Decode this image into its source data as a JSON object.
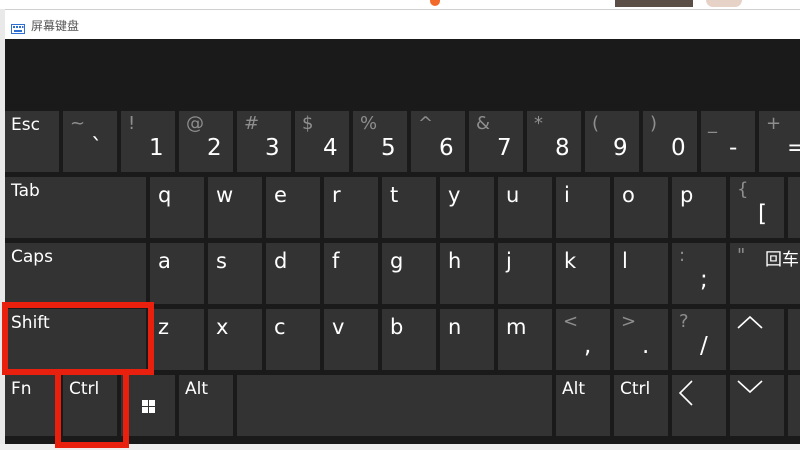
{
  "window": {
    "title": "屏幕键盘"
  },
  "keyboard": {
    "row1": {
      "esc": "Esc",
      "backtick": {
        "shift": "~",
        "main": "`"
      },
      "k1": {
        "shift": "!",
        "main": "1"
      },
      "k2": {
        "shift": "@",
        "main": "2"
      },
      "k3": {
        "shift": "#",
        "main": "3"
      },
      "k4": {
        "shift": "$",
        "main": "4"
      },
      "k5": {
        "shift": "%",
        "main": "5"
      },
      "k6": {
        "shift": "^",
        "main": "6"
      },
      "k7": {
        "shift": "&",
        "main": "7"
      },
      "k8": {
        "shift": "*",
        "main": "8"
      },
      "k9": {
        "shift": "(",
        "main": "9"
      },
      "k0": {
        "shift": ")",
        "main": "0"
      },
      "minus": {
        "shift": "_",
        "main": "-"
      },
      "equals": {
        "shift": "+",
        "main": "="
      }
    },
    "row2": {
      "tab": "Tab",
      "q": "q",
      "w": "w",
      "e": "e",
      "r": "r",
      "t": "t",
      "y": "y",
      "u": "u",
      "i": "i",
      "o": "o",
      "p": "p",
      "lbracket": {
        "shift": "{",
        "main": "["
      },
      "rbracket": {
        "shift": "}",
        "main": "]"
      }
    },
    "row3": {
      "caps": "Caps",
      "a": "a",
      "s": "s",
      "d": "d",
      "f": "f",
      "g": "g",
      "h": "h",
      "j": "j",
      "k": "k",
      "l": "l",
      "semicolon": {
        "shift": ":",
        "main": ";"
      },
      "quote": {
        "shift": "\"",
        "main": "'"
      },
      "enter": "回车"
    },
    "row4": {
      "shift": "Shift",
      "z": "z",
      "x": "x",
      "c": "c",
      "v": "v",
      "b": "b",
      "n": "n",
      "m": "m",
      "comma": {
        "shift": "<",
        "main": ","
      },
      "period": {
        "shift": ">",
        "main": "."
      },
      "slash": {
        "shift": "?",
        "main": "/"
      }
    },
    "row5": {
      "fn": "Fn",
      "ctrl_left": "Ctrl",
      "alt_left": "Alt",
      "alt_right": "Alt",
      "ctrl_right": "Ctrl"
    }
  },
  "colors": {
    "panel": "#1a1a1a",
    "key": "#333333",
    "key_text": "#ffffff",
    "shift_text": "#8e8e8e",
    "highlight": "#e8200d"
  },
  "icons": [
    "keyboard-icon",
    "windows-logo-icon",
    "arrow-up-icon",
    "arrow-left-icon",
    "arrow-down-icon"
  ],
  "highlighted_keys": [
    "Shift",
    "Ctrl"
  ]
}
